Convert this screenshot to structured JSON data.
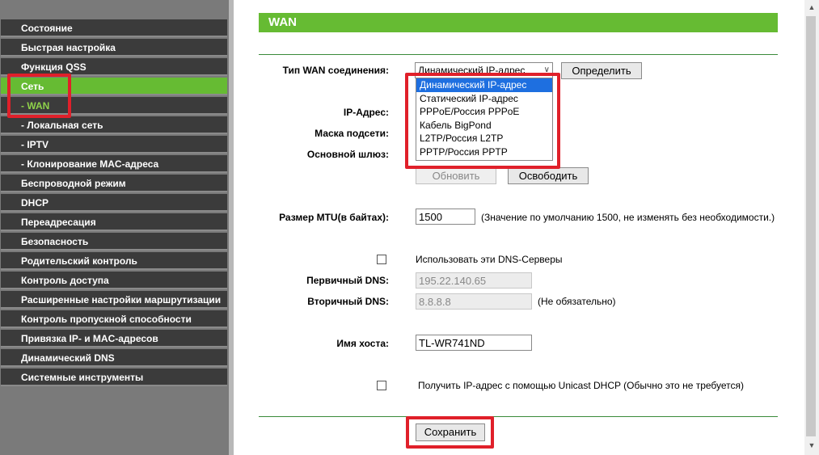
{
  "sidebar": {
    "items": [
      {
        "label": "Состояние"
      },
      {
        "label": "Быстрая настройка"
      },
      {
        "label": "Функция QSS"
      },
      {
        "label": "Сеть"
      },
      {
        "label": "- WAN"
      },
      {
        "label": "- Локальная сеть"
      },
      {
        "label": "- IPTV"
      },
      {
        "label": "- Клонирование MAC-адреса"
      },
      {
        "label": "Беспроводной режим"
      },
      {
        "label": "DHCP"
      },
      {
        "label": "Переадресация"
      },
      {
        "label": "Безопасность"
      },
      {
        "label": "Родительский контроль"
      },
      {
        "label": "Контроль доступа"
      },
      {
        "label": "Расширенные настройки маршрутизации"
      },
      {
        "label": "Контроль пропускной способности"
      },
      {
        "label": "Привязка IP- и MAC-адресов"
      },
      {
        "label": "Динамический DNS"
      },
      {
        "label": "Системные инструменты"
      }
    ],
    "active_color": "#66bb33"
  },
  "page": {
    "title": "WAN",
    "accent_color": "#66bb33"
  },
  "form": {
    "wan_type_label": "Тип WAN соединения:",
    "wan_type_value": "Динамический IP-адрес",
    "detect_button": "Определить",
    "wan_options": [
      "Динамический IP-адрес",
      "Статический IP-адрес",
      "PPPoE/Россия PPPoE",
      "Кабель BigPond",
      "L2TP/Россия L2TP",
      "PPTP/Россия PPTP"
    ],
    "ip_label": "IP-Адрес:",
    "mask_label": "Маска подсети:",
    "gateway_label": "Основной шлюз:",
    "renew_button": "Обновить",
    "release_button": "Освободить",
    "mtu_label": "Размер MTU(в байтах):",
    "mtu_value": "1500",
    "mtu_hint": "(Значение по умолчанию 1500, не изменять без необходимости.)",
    "use_dns_label": "Использовать эти DNS-Серверы",
    "primary_dns_label": "Первичный DNS:",
    "primary_dns_value": "195.22.140.65",
    "secondary_dns_label": "Вторичный DNS:",
    "secondary_dns_value": "8.8.8.8",
    "optional_hint": "(Не обязательно)",
    "hostname_label": "Имя хоста:",
    "hostname_value": "TL-WR741ND",
    "unicast_label": "Получить IP-адрес с помощью Unicast DHCP (Обычно это не требуется)",
    "save_button": "Сохранить"
  },
  "highlight_color": "#e0202a"
}
